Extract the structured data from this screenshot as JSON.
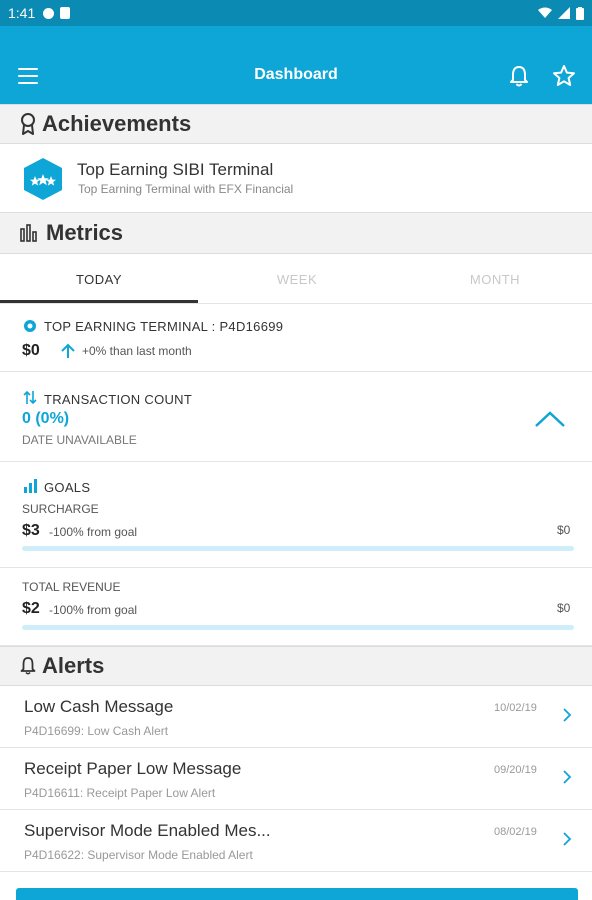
{
  "status_bar": {
    "time": "1:41"
  },
  "app_bar": {
    "title": "Dashboard",
    "menu_icon": "menu-icon",
    "bell_icon": "bell-icon",
    "star_icon": "star-icon"
  },
  "achievements": {
    "header": "Achievements",
    "items": [
      {
        "title": "Top Earning SIBI Terminal",
        "subtitle": "Top Earning Terminal with EFX Financial"
      }
    ]
  },
  "metrics": {
    "header": "Metrics",
    "tabs": [
      {
        "label": "TODAY",
        "active": true
      },
      {
        "label": "WEEK",
        "active": false
      },
      {
        "label": "MONTH",
        "active": false
      }
    ],
    "top_terminal": {
      "heading": "TOP EARNING TERMINAL : P4D16699",
      "amount": "$0",
      "change": "+0% than last month"
    },
    "transaction_count": {
      "heading": "TRANSACTION COUNT",
      "value": "0 (0%)",
      "date_label": "DATE UNAVAILABLE"
    },
    "goals": {
      "heading": "GOALS",
      "items": [
        {
          "label": "SURCHARGE",
          "amount": "$3",
          "note": "-100% from goal",
          "goal": "$0",
          "progress": 0
        },
        {
          "label": "TOTAL REVENUE",
          "amount": "$2",
          "note": "-100% from goal",
          "goal": "$0",
          "progress": 0
        }
      ]
    }
  },
  "alerts": {
    "header": "Alerts",
    "items": [
      {
        "title": "Low Cash Message",
        "subtitle": "P4D16699: Low Cash Alert",
        "date": "10/02/19"
      },
      {
        "title": "Receipt Paper Low Message",
        "subtitle": "P4D16611: Receipt Paper Low Alert",
        "date": "09/20/19"
      },
      {
        "title": "Supervisor Mode Enabled Mes...",
        "subtitle": "P4D16622: Supervisor Mode Enabled Alert",
        "date": "08/02/19"
      }
    ]
  },
  "colors": {
    "primary": "#0da6d6",
    "status_bar": "#0b8bb3",
    "section_bg": "#f2f2f2",
    "progress_track": "#cfeefa"
  }
}
